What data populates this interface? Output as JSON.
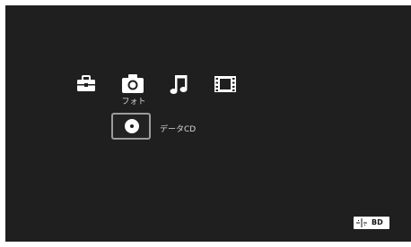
{
  "categories": [
    {
      "name": "toolbox-icon"
    },
    {
      "name": "camera-icon",
      "label": "フォト",
      "selected": true
    },
    {
      "name": "music-note-icon"
    },
    {
      "name": "film-icon"
    }
  ],
  "item": {
    "icon": "disc-icon",
    "label": "データCD"
  },
  "badge": {
    "icon": "connection-icon",
    "text": "BD"
  },
  "colors": {
    "background": "#1f1f1f",
    "text": "#d8d8d8",
    "selection": "#9c9c9c"
  }
}
